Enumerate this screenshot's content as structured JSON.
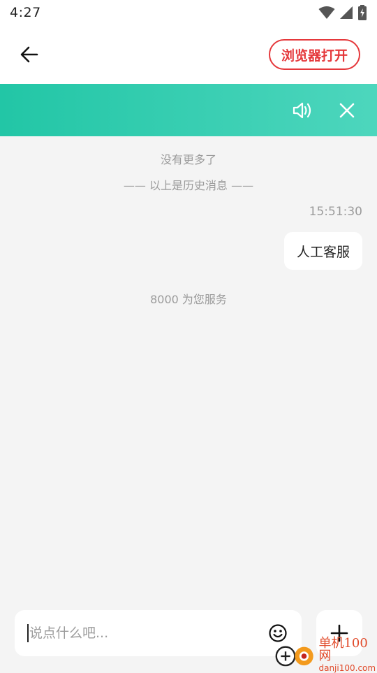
{
  "status_bar": {
    "time": "4:27",
    "icons": [
      "wifi-icon",
      "signal-icon",
      "battery-charging-icon"
    ]
  },
  "app_bar": {
    "back_icon": "arrow-left-icon",
    "open_browser_label": "浏览器打开"
  },
  "banner": {
    "color_start": "#22c6a6",
    "color_end": "#4dd6bd",
    "speaker_icon": "speaker-icon",
    "close_icon": "close-icon"
  },
  "chat": {
    "no_more": "没有更多了",
    "history_divider": "—— 以上是历史消息 ——",
    "timestamp": "15:51:30",
    "user_message": "人工客服",
    "agent_notice": "8000 为您服务"
  },
  "input": {
    "placeholder": "说点什么吧...",
    "emoji_icon": "smiley-icon",
    "plus_icon": "plus-icon"
  },
  "watermark": {
    "cn": "单机100网",
    "en": "danji100.com"
  },
  "colors": {
    "accent_red": "#e5383b",
    "background": "#f4f4f4"
  }
}
